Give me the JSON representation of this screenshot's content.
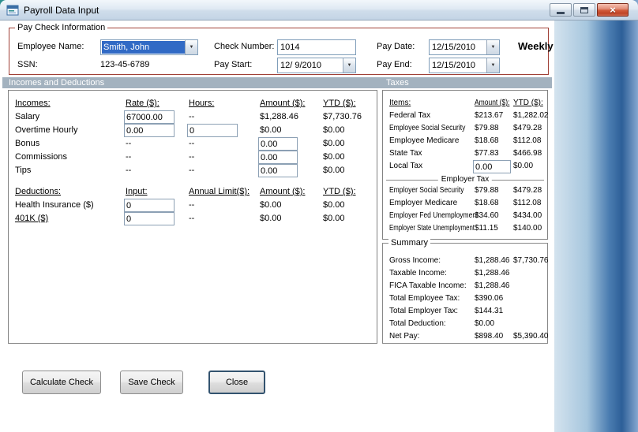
{
  "window": {
    "title": "Payroll Data Input"
  },
  "icons": {
    "dropdown": "▼",
    "close": "×"
  },
  "paycheck_info": {
    "legend": "Pay Check Information",
    "employee_name_label": "Employee Name:",
    "employee_name_value": "Smith, John",
    "ssn_label": "SSN:",
    "ssn_value": "123-45-6789",
    "check_number_label": "Check Number:",
    "check_number_value": "1014",
    "pay_start_label": "Pay Start:",
    "pay_start_value": "12/ 9/2010",
    "pay_date_label": "Pay Date:",
    "pay_date_value": "12/15/2010",
    "pay_end_label": "Pay End:",
    "pay_end_value": "12/15/2010",
    "frequency": "Weekly"
  },
  "sections": {
    "incomes_deductions": "Incomes and Deductions",
    "taxes": "Taxes"
  },
  "incomes": {
    "headers": [
      "Incomes:",
      "Rate ($):",
      "Hours:",
      "Amount ($):",
      "YTD ($):"
    ],
    "rows": [
      {
        "label": "Salary",
        "rate": "67000.00",
        "hours": "--",
        "amount": "$1,288.46",
        "ytd": "$7,730.76"
      },
      {
        "label": "Overtime Hourly",
        "rate": "0.00",
        "hours": "0",
        "amount": "$0.00",
        "ytd": "$0.00"
      },
      {
        "label": "Bonus",
        "rate": "--",
        "hours": "--",
        "amount": "0.00",
        "ytd": "$0.00"
      },
      {
        "label": "Commissions",
        "rate": "--",
        "hours": "--",
        "amount": "0.00",
        "ytd": "$0.00"
      },
      {
        "label": "Tips",
        "rate": "--",
        "hours": "--",
        "amount": "0.00",
        "ytd": "$0.00"
      }
    ]
  },
  "deductions": {
    "headers": [
      "Deductions:",
      "Input:",
      "Annual Limit($):",
      "Amount ($):",
      "YTD ($):"
    ],
    "rows": [
      {
        "label": "Health Insurance ($)",
        "input": "0",
        "limit": "--",
        "amount": "$0.00",
        "ytd": "$0.00"
      },
      {
        "label": "401K ($)",
        "input": "0",
        "limit": "--",
        "amount": "$0.00",
        "ytd": "$0.00"
      }
    ]
  },
  "taxes": {
    "headers": [
      "Items:",
      "Amount ($):",
      "YTD ($):"
    ],
    "employee_rows": [
      {
        "label": "Federal Tax",
        "amount": "$213.67",
        "ytd": "$1,282.02"
      },
      {
        "label": "Employee Social Security",
        "amount": "$79.88",
        "ytd": "$479.28"
      },
      {
        "label": "Employee Medicare",
        "amount": "$18.68",
        "ytd": "$112.08"
      },
      {
        "label": "State Tax",
        "amount": "$77.83",
        "ytd": "$466.98"
      },
      {
        "label": "Local Tax",
        "amount": "0.00",
        "ytd": "$0.00"
      }
    ],
    "employer_divider": "Employer Tax",
    "employer_rows": [
      {
        "label": "Employer Social Security",
        "amount": "$79.88",
        "ytd": "$479.28"
      },
      {
        "label": "Employer Medicare",
        "amount": "$18.68",
        "ytd": "$112.08"
      },
      {
        "label": "Employer Fed Unemployment",
        "amount": "$34.60",
        "ytd": "$434.00"
      },
      {
        "label": "Employer State Unemployment",
        "amount": "$11.15",
        "ytd": "$140.00"
      }
    ]
  },
  "summary": {
    "legend": "Summary",
    "rows": [
      {
        "label": "Gross Income:",
        "amount": "$1,288.46",
        "ytd": "$7,730.76"
      },
      {
        "label": "Taxable Income:",
        "amount": "$1,288.46",
        "ytd": ""
      },
      {
        "label": "FICA Taxable Income:",
        "amount": "$1,288.46",
        "ytd": ""
      },
      {
        "label": "Total Employee Tax:",
        "amount": "$390.06",
        "ytd": ""
      },
      {
        "label": "Total Employer Tax:",
        "amount": "$144.31",
        "ytd": ""
      },
      {
        "label": "Total Deduction:",
        "amount": "$0.00",
        "ytd": ""
      },
      {
        "label": "Net Pay:",
        "amount": "$898.40",
        "ytd": "$5,390.40"
      }
    ]
  },
  "buttons": {
    "calculate": "Calculate Check",
    "save": "Save Check",
    "close": "Close"
  }
}
